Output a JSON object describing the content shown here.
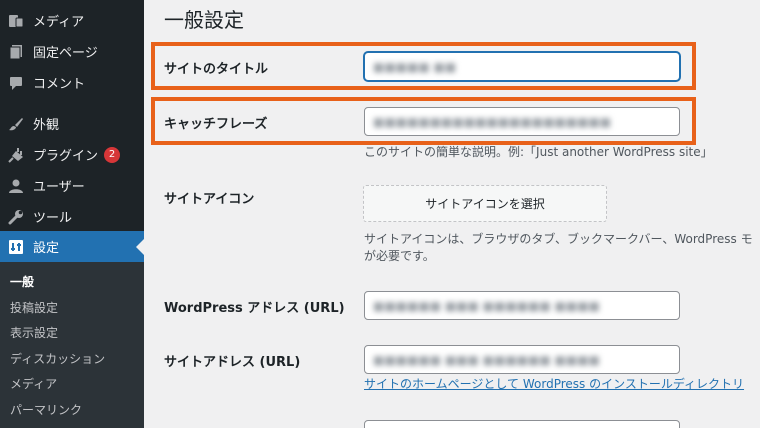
{
  "sidebar": {
    "items": [
      {
        "label": "メディア",
        "icon": "media-icon"
      },
      {
        "label": "固定ページ",
        "icon": "page-icon"
      },
      {
        "label": "コメント",
        "icon": "comment-icon"
      },
      {
        "label": "外観",
        "icon": "brush-icon"
      },
      {
        "label": "プラグイン",
        "icon": "plugin-icon",
        "badge": "2"
      },
      {
        "label": "ユーザー",
        "icon": "user-icon"
      },
      {
        "label": "ツール",
        "icon": "wrench-icon"
      },
      {
        "label": "設定",
        "icon": "settings-icon",
        "current": true
      }
    ],
    "submenu": [
      "一般",
      "投稿設定",
      "表示設定",
      "ディスカッション",
      "メディア",
      "パーマリンク"
    ]
  },
  "main": {
    "title": "一般設定",
    "fields": {
      "site_title": {
        "label": "サイトのタイトル"
      },
      "tagline": {
        "label": "キャッチフレーズ",
        "description": "このサイトの簡単な説明。例:「Just another WordPress site」"
      },
      "site_icon": {
        "label": "サイトアイコン",
        "button": "サイトアイコンを選択",
        "description_1": "サイトアイコンは、ブラウザのタブ、ブックマークバー、WordPress モ",
        "description_2": "が必要です。"
      },
      "wp_address": {
        "label": "WordPress アドレス (URL)"
      },
      "site_address": {
        "label": "サイトアドレス (URL)",
        "link": "サイトのホームページとして WordPress のインストールディレクトリ"
      }
    }
  },
  "colors": {
    "sidebar_bg": "#1d2327",
    "accent": "#2271b1",
    "highlight": "#e8611a",
    "badge": "#d63638"
  }
}
